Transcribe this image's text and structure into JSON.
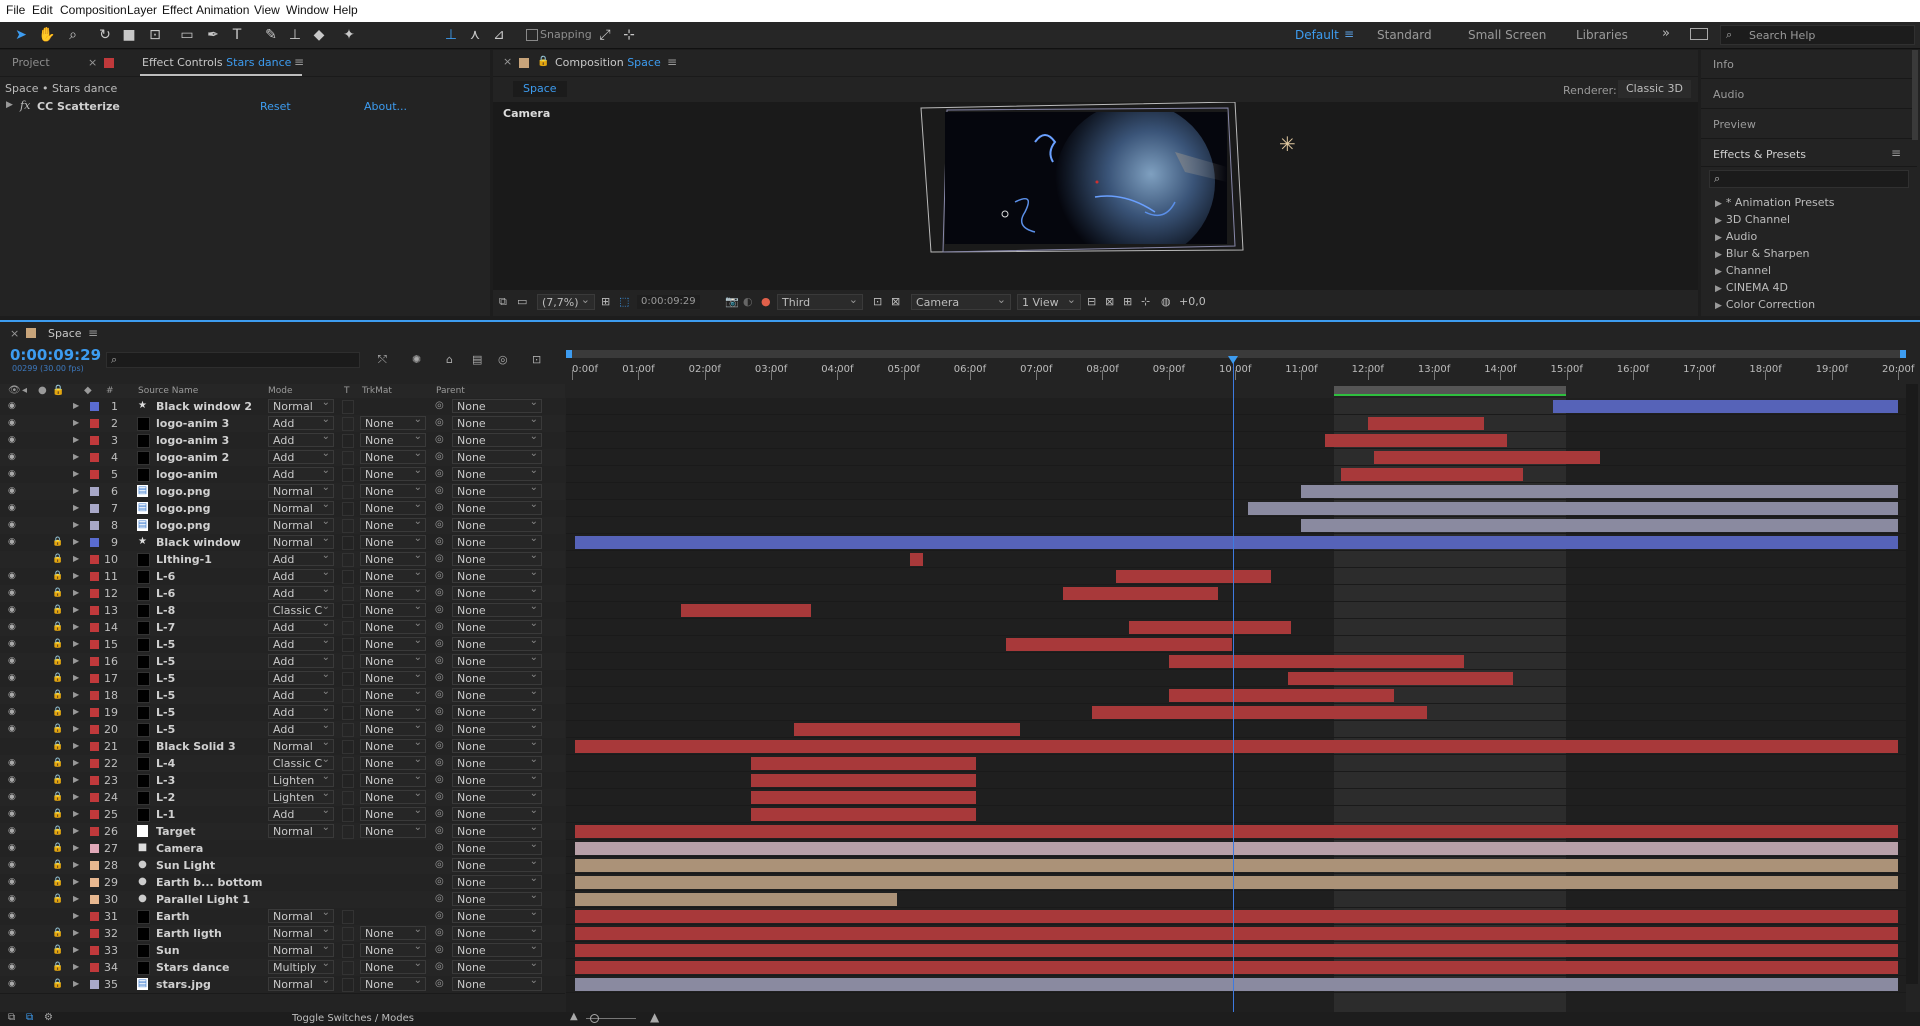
{
  "menu": [
    "File",
    "Edit",
    "Composition",
    "Layer",
    "Effect",
    "Animation",
    "View",
    "Window",
    "Help"
  ],
  "toolbar": {
    "snapping_label": "Snapping",
    "workspaces": [
      "Default",
      "Standard",
      "Small Screen",
      "Libraries"
    ],
    "active_workspace": "Default",
    "search_placeholder": "Search Help"
  },
  "left_panel": {
    "tab_project": "Project",
    "tab_effect_controls_prefix": "Effect Controls",
    "tab_effect_controls_layer": "Stars dance",
    "breadcrumb": "Space • Stars dance",
    "effect_name": "CC Scatterize",
    "reset": "Reset",
    "about": "About..."
  },
  "composition": {
    "tab_prefix": "Composition",
    "tab_name": "Space",
    "subtab": "Space",
    "renderer_label": "Renderer:",
    "renderer_value": "Classic 3D",
    "view_label": "Camera",
    "zoom": "(7,7%)",
    "timecode": "0:00:09:29",
    "resolution": "Third",
    "camera": "Camera",
    "views": "1 View",
    "exposure": "+0,0"
  },
  "right_panel": {
    "items": [
      "Info",
      "Audio",
      "Preview"
    ],
    "effects_title": "Effects & Presets",
    "effects": [
      "* Animation Presets",
      "3D Channel",
      "Audio",
      "Blur & Sharpen",
      "Channel",
      "CINEMA 4D",
      "Color Correction"
    ]
  },
  "timeline": {
    "comp_tab": "Space",
    "timecode": "0:00:09:29",
    "frame_info": "00299 (30.00 fps)",
    "col_source": "Source Name",
    "col_mode": "Mode",
    "col_t": "T",
    "col_trkmat": "TrkMat",
    "col_parent": "Parent",
    "col_hash": "#",
    "ruler": [
      "0:00f",
      "01:00f",
      "02:00f",
      "03:00f",
      "04:00f",
      "05:00f",
      "06:00f",
      "07:00f",
      "08:00f",
      "09:00f",
      "10:00f",
      "11:00f",
      "12:00f",
      "13:00f",
      "14:00f",
      "15:00f",
      "16:00f",
      "17:00f",
      "18:00f",
      "19:00f",
      "20:00f"
    ],
    "duration_seconds": 20,
    "current_time_seconds": 9.97,
    "work_area_seconds": [
      11.5,
      15.0
    ],
    "toggle_label": "Toggle Switches / Modes",
    "layers": [
      {
        "n": "1",
        "name": "Black window 2",
        "mode": "Normal",
        "trk": "",
        "parent": "None",
        "color": "#5a6cd0",
        "icon": "star",
        "eye": true,
        "lock": false,
        "bar": [
          14.8,
          20.0
        ],
        "barColor": "#5663b8"
      },
      {
        "n": "2",
        "name": "logo-anim 3",
        "mode": "Add",
        "trk": "None",
        "parent": "None",
        "color": "#c0393b",
        "icon": "solid",
        "eye": true,
        "lock": false,
        "bar": [
          12.0,
          13.75
        ],
        "barColor": "#a8393a"
      },
      {
        "n": "3",
        "name": "logo-anim 3",
        "mode": "Add",
        "trk": "None",
        "parent": "None",
        "color": "#c0393b",
        "icon": "solid",
        "eye": true,
        "lock": false,
        "bar": [
          11.35,
          14.1
        ],
        "barColor": "#a8393a"
      },
      {
        "n": "4",
        "name": "logo-anim 2",
        "mode": "Add",
        "trk": "None",
        "parent": "None",
        "color": "#c0393b",
        "icon": "solid",
        "eye": true,
        "lock": false,
        "bar": [
          12.1,
          15.5
        ],
        "barColor": "#a8393a"
      },
      {
        "n": "5",
        "name": "logo-anim",
        "mode": "Add",
        "trk": "None",
        "parent": "None",
        "color": "#c0393b",
        "icon": "solid",
        "eye": true,
        "lock": false,
        "bar": [
          11.6,
          14.35
        ],
        "barColor": "#a8393a"
      },
      {
        "n": "6",
        "name": "logo.png",
        "mode": "Normal",
        "trk": "None",
        "parent": "None",
        "color": "#a8a8c8",
        "icon": "png",
        "eye": true,
        "lock": false,
        "bar": [
          11.0,
          20.0
        ],
        "barColor": "#8a8aa0"
      },
      {
        "n": "7",
        "name": "logo.png",
        "mode": "Normal",
        "trk": "None",
        "parent": "None",
        "color": "#a8a8c8",
        "icon": "png",
        "eye": true,
        "lock": false,
        "bar": [
          10.2,
          20.0
        ],
        "barColor": "#8a8aa0"
      },
      {
        "n": "8",
        "name": "logo.png",
        "mode": "Normal",
        "trk": "None",
        "parent": "None",
        "color": "#a8a8c8",
        "icon": "png",
        "eye": true,
        "lock": false,
        "bar": [
          11.0,
          20.0
        ],
        "barColor": "#8a8aa0"
      },
      {
        "n": "9",
        "name": "Black window",
        "mode": "Normal",
        "trk": "None",
        "parent": "None",
        "color": "#5a6cd0",
        "icon": "star",
        "eye": true,
        "lock": true,
        "bar": [
          0.05,
          20.0
        ],
        "barColor": "#5663b8"
      },
      {
        "n": "10",
        "name": "LIthing-1",
        "mode": "Add",
        "trk": "None",
        "parent": "None",
        "color": "#c0393b",
        "icon": "solid",
        "eye": false,
        "lock": true,
        "bar": [
          5.1,
          5.3
        ],
        "barColor": "#a8393a"
      },
      {
        "n": "11",
        "name": "L-6",
        "mode": "Add",
        "trk": "None",
        "parent": "None",
        "color": "#c0393b",
        "icon": "solid",
        "eye": true,
        "lock": true,
        "bar": [
          8.2,
          10.55
        ],
        "barColor": "#a8393a"
      },
      {
        "n": "12",
        "name": "L-6",
        "mode": "Add",
        "trk": "None",
        "parent": "None",
        "color": "#c0393b",
        "icon": "solid",
        "eye": true,
        "lock": true,
        "bar": [
          7.4,
          9.75
        ],
        "barColor": "#a8393a"
      },
      {
        "n": "13",
        "name": "L-8",
        "mode": "Classic C",
        "trk": "None",
        "parent": "None",
        "color": "#c0393b",
        "icon": "solid",
        "eye": true,
        "lock": true,
        "bar": [
          1.65,
          3.6
        ],
        "barColor": "#a8393a"
      },
      {
        "n": "14",
        "name": "L-7",
        "mode": "Add",
        "trk": "None",
        "parent": "None",
        "color": "#c0393b",
        "icon": "solid",
        "eye": true,
        "lock": true,
        "bar": [
          8.4,
          10.85
        ],
        "barColor": "#a8393a"
      },
      {
        "n": "15",
        "name": "L-5",
        "mode": "Add",
        "trk": "None",
        "parent": "None",
        "color": "#c0393b",
        "icon": "solid",
        "eye": true,
        "lock": true,
        "bar": [
          6.55,
          9.95
        ],
        "barColor": "#a8393a"
      },
      {
        "n": "16",
        "name": "L-5",
        "mode": "Add",
        "trk": "None",
        "parent": "None",
        "color": "#c0393b",
        "icon": "solid",
        "eye": true,
        "lock": true,
        "bar": [
          9.0,
          13.45
        ],
        "barColor": "#a8393a"
      },
      {
        "n": "17",
        "name": "L-5",
        "mode": "Add",
        "trk": "None",
        "parent": "None",
        "color": "#c0393b",
        "icon": "solid",
        "eye": true,
        "lock": true,
        "bar": [
          10.8,
          14.2
        ],
        "barColor": "#a8393a"
      },
      {
        "n": "18",
        "name": "L-5",
        "mode": "Add",
        "trk": "None",
        "parent": "None",
        "color": "#c0393b",
        "icon": "solid",
        "eye": true,
        "lock": true,
        "bar": [
          9.0,
          12.4
        ],
        "barColor": "#a8393a"
      },
      {
        "n": "19",
        "name": "L-5",
        "mode": "Add",
        "trk": "None",
        "parent": "None",
        "color": "#c0393b",
        "icon": "solid",
        "eye": true,
        "lock": true,
        "bar": [
          7.85,
          12.9
        ],
        "barColor": "#a8393a"
      },
      {
        "n": "20",
        "name": "L-5",
        "mode": "Add",
        "trk": "None",
        "parent": "None",
        "color": "#c0393b",
        "icon": "solid",
        "eye": true,
        "lock": true,
        "bar": [
          3.35,
          6.75
        ],
        "barColor": "#a8393a"
      },
      {
        "n": "21",
        "name": "Black Solid 3",
        "mode": "Normal",
        "trk": "None",
        "parent": "None",
        "color": "#c0393b",
        "icon": "solid",
        "eye": false,
        "lock": true,
        "bar": [
          0.05,
          20.0
        ],
        "barColor": "#a8393a"
      },
      {
        "n": "22",
        "name": "L-4",
        "mode": "Classic C",
        "trk": "None",
        "parent": "None",
        "color": "#c0393b",
        "icon": "solid",
        "eye": true,
        "lock": true,
        "bar": [
          2.7,
          6.1
        ],
        "barColor": "#a8393a"
      },
      {
        "n": "23",
        "name": "L-3",
        "mode": "Lighten",
        "trk": "None",
        "parent": "None",
        "color": "#c0393b",
        "icon": "solid",
        "eye": true,
        "lock": true,
        "bar": [
          2.7,
          6.1
        ],
        "barColor": "#a8393a"
      },
      {
        "n": "24",
        "name": "L-2",
        "mode": "Lighten",
        "trk": "None",
        "parent": "None",
        "color": "#c0393b",
        "icon": "solid",
        "eye": true,
        "lock": true,
        "bar": [
          2.7,
          6.1
        ],
        "barColor": "#a8393a"
      },
      {
        "n": "25",
        "name": "L-1",
        "mode": "Add",
        "trk": "None",
        "parent": "None",
        "color": "#c0393b",
        "icon": "solid",
        "eye": true,
        "lock": true,
        "bar": [
          2.7,
          6.1
        ],
        "barColor": "#a8393a"
      },
      {
        "n": "26",
        "name": "Target",
        "mode": "Normal",
        "trk": "None",
        "parent": "None",
        "color": "#c0393b",
        "icon": "white",
        "eye": true,
        "lock": true,
        "bar": [
          0.05,
          20.0
        ],
        "barColor": "#a8393a"
      },
      {
        "n": "27",
        "name": "Camera",
        "mode": "",
        "trk": "",
        "parent": "None",
        "color": "#e0a8b8",
        "icon": "camera",
        "eye": true,
        "lock": true,
        "bar": [
          0.05,
          20.0
        ],
        "barColor": "#b8a0a8"
      },
      {
        "n": "28",
        "name": "Sun Light",
        "mode": "",
        "trk": "",
        "parent": "None",
        "color": "#e8b890",
        "icon": "light",
        "eye": true,
        "lock": true,
        "bar": [
          0.05,
          20.0
        ],
        "barColor": "#ab9278"
      },
      {
        "n": "29",
        "name": "Earth b... bottom",
        "mode": "",
        "trk": "",
        "parent": "None",
        "color": "#e8b890",
        "icon": "light",
        "eye": true,
        "lock": true,
        "bar": [
          0.05,
          20.0
        ],
        "barColor": "#ab9278"
      },
      {
        "n": "30",
        "name": "Parallel Light 1",
        "mode": "",
        "trk": "",
        "parent": "None",
        "color": "#e8b890",
        "icon": "light",
        "eye": true,
        "lock": true,
        "bar": [
          0.05,
          4.9
        ],
        "barColor": "#ab9278"
      },
      {
        "n": "31",
        "name": "Earth",
        "mode": "Normal",
        "trk": "",
        "parent": "None",
        "color": "#c0393b",
        "icon": "solid",
        "eye": true,
        "lock": false,
        "bar": [
          0.05,
          20.0
        ],
        "barColor": "#a8393a"
      },
      {
        "n": "32",
        "name": "Earth ligth",
        "mode": "Normal",
        "trk": "None",
        "parent": "None",
        "color": "#c0393b",
        "icon": "solid",
        "eye": true,
        "lock": true,
        "bar": [
          0.05,
          20.0
        ],
        "barColor": "#a8393a"
      },
      {
        "n": "33",
        "name": "Sun",
        "mode": "Normal",
        "trk": "None",
        "parent": "None",
        "color": "#c0393b",
        "icon": "solid",
        "eye": true,
        "lock": true,
        "bar": [
          0.05,
          20.0
        ],
        "barColor": "#a8393a"
      },
      {
        "n": "34",
        "name": "Stars dance",
        "mode": "Multiply",
        "trk": "None",
        "parent": "None",
        "color": "#c0393b",
        "icon": "solid",
        "eye": true,
        "lock": true,
        "bar": [
          0.05,
          20.0
        ],
        "barColor": "#a8393a"
      },
      {
        "n": "35",
        "name": "stars.jpg",
        "mode": "Normal",
        "trk": "None",
        "parent": "None",
        "color": "#a8a8c8",
        "icon": "png",
        "eye": true,
        "lock": true,
        "bar": [
          0.05,
          20.0
        ],
        "barColor": "#8a8aa0"
      }
    ]
  }
}
